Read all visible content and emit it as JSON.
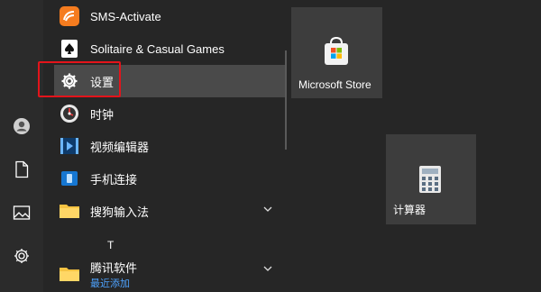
{
  "rail": {
    "items": [
      {
        "name": "user-icon"
      },
      {
        "name": "documents-icon"
      },
      {
        "name": "pictures-icon"
      },
      {
        "name": "settings-gear-icon"
      }
    ]
  },
  "apps": [
    {
      "label": "SMS-Activate",
      "icon": "sms-activate-icon"
    },
    {
      "label": "Solitaire & Casual Games",
      "icon": "solitaire-icon"
    },
    {
      "label": "设置",
      "icon": "gear-icon"
    },
    {
      "label": "时钟",
      "icon": "clock-icon"
    },
    {
      "label": "视频编辑器",
      "icon": "video-editor-icon"
    },
    {
      "label": "手机连接",
      "icon": "phone-link-icon"
    },
    {
      "label": "搜狗输入法",
      "icon": "folder-icon"
    },
    {
      "label": "腾讯软件",
      "icon": "folder-icon",
      "sublabel": "最近添加"
    }
  ],
  "section_letter": "T",
  "tiles": [
    {
      "label": "Microsoft Store",
      "icon": "store-icon"
    },
    {
      "label": "计算器",
      "icon": "calculator-icon"
    }
  ],
  "colors": {
    "highlight": "#e3141b",
    "accent": "#4ea3ff"
  }
}
